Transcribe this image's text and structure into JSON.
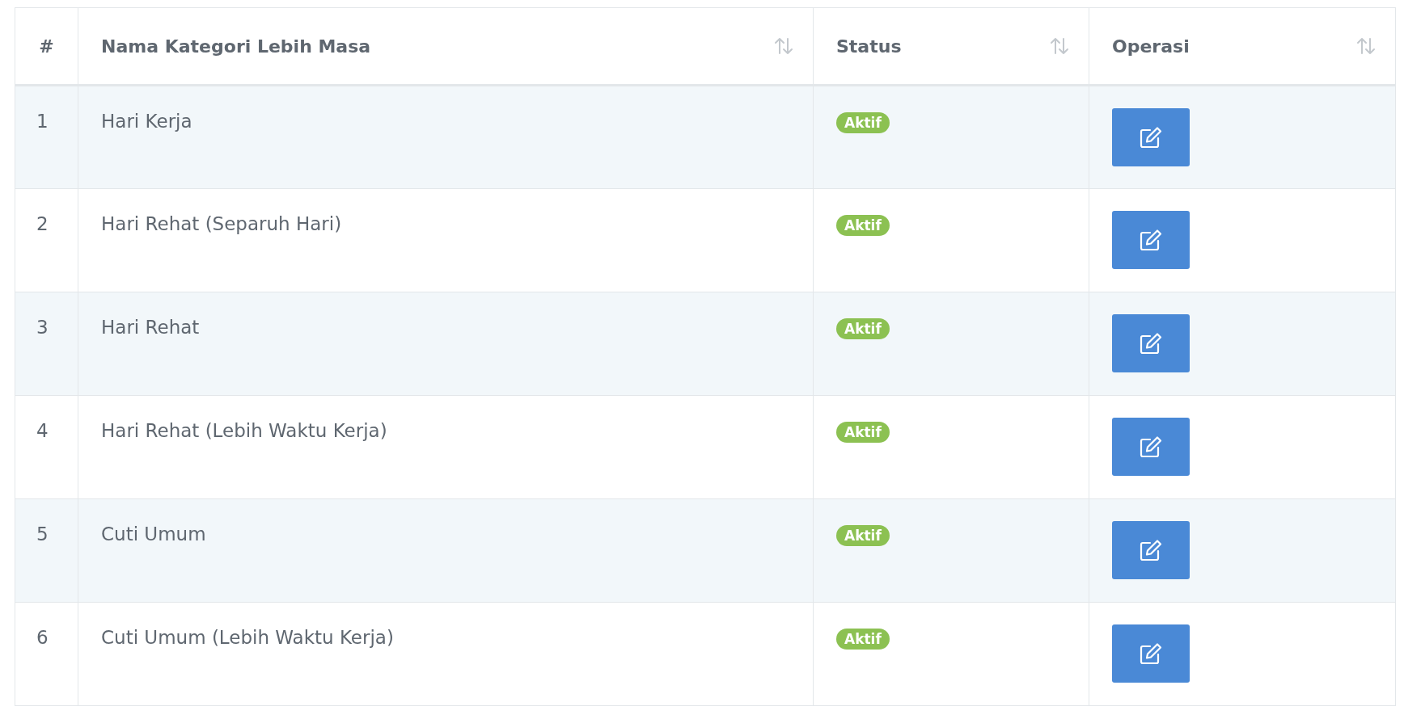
{
  "table": {
    "columns": [
      {
        "label": "#",
        "sortable": false
      },
      {
        "label": "Nama Kategori Lebih Masa",
        "sortable": true
      },
      {
        "label": "Status",
        "sortable": true
      },
      {
        "label": "Operasi",
        "sortable": true
      }
    ],
    "rows": [
      {
        "number": "1",
        "name": "Hari Kerja",
        "status": "Aktif"
      },
      {
        "number": "2",
        "name": "Hari Rehat (Separuh Hari)",
        "status": "Aktif"
      },
      {
        "number": "3",
        "name": "Hari Rehat",
        "status": "Aktif"
      },
      {
        "number": "4",
        "name": "Hari Rehat (Lebih Waktu Kerja)",
        "status": "Aktif"
      },
      {
        "number": "5",
        "name": "Cuti Umum",
        "status": "Aktif"
      },
      {
        "number": "6",
        "name": "Cuti Umum (Lebih Waktu Kerja)",
        "status": "Aktif"
      }
    ]
  }
}
